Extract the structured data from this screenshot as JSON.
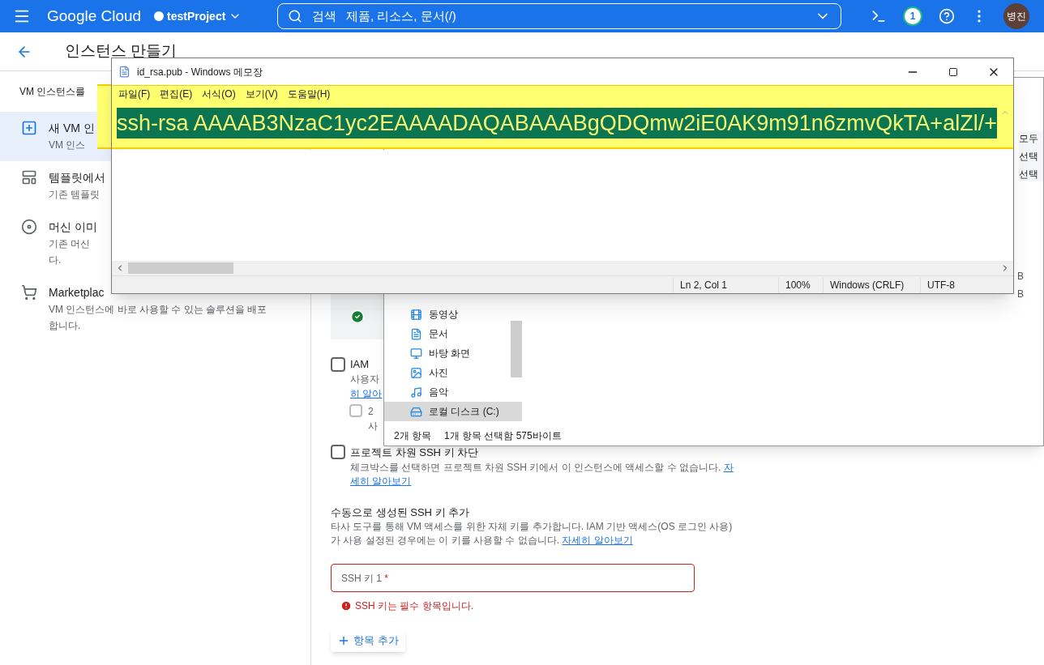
{
  "topbar": {
    "brand": "Google Cloud",
    "project": "testProject",
    "search_label": "검색",
    "search_placeholder": "제품, 리소스, 문서(/)",
    "notifications": "1",
    "avatar": "병진"
  },
  "page": {
    "title": "인스턴스 만들기",
    "intro": "VM 인스턴스를"
  },
  "sidebar": {
    "items": [
      {
        "kind": "new",
        "title": "새 VM 인",
        "desc": "VM 인스",
        "selected": true
      },
      {
        "kind": "template",
        "title": "템플릿에서",
        "desc": "기존 템플릿",
        "selected": false
      },
      {
        "kind": "image",
        "title": "머신 이미",
        "desc": "기존 머신",
        "desc2": "다.",
        "selected": false
      },
      {
        "kind": "market",
        "title": "Marketplac",
        "desc": "VM 인스턴스에 바로 사용할 수 있는 솔루션을 배포",
        "desc2": "합니다.",
        "selected": false
      }
    ]
  },
  "form": {
    "iam": {
      "label": "IAM",
      "desc": "사용자",
      "link": "히 알아",
      "checked": false,
      "sub_label": "2",
      "sub_desc": "사",
      "sub_checked": false
    },
    "block": {
      "label": "프로젝트 차원 SSH 키 차단",
      "desc": "체크박스를 선택하면 프로젝트 차원 SSH 키에서 이 인스턴스에 액세스할 수 없습니다.",
      "link_a": "자",
      "link_b": "세히 알아보기",
      "checked": false
    },
    "manual": {
      "heading": "수동으로 생성된 SSH 키 추가",
      "desc": "타사 도구를 통해 VM 액세스를 위한 자체 키를 추가합니다. IAM 기반 액세스(OS 로그인 사용)가 사용 설정된 경우에는 이 키를 사용할 수 없습니다.",
      "link": "자세히 알아보기"
    },
    "key_field": {
      "label": "SSH 키 1",
      "required": "*",
      "error": "SSH 키는 필수 항목입니다."
    },
    "add_button": "항목 추가"
  },
  "explorer": {
    "ribbon": [
      "모두",
      "선택",
      "선택"
    ],
    "nav": [
      {
        "kind": "video",
        "label": "동영상",
        "selected": false
      },
      {
        "kind": "doc",
        "label": "문서",
        "selected": false
      },
      {
        "kind": "desktop",
        "label": "바탕 화면",
        "selected": false
      },
      {
        "kind": "photo",
        "label": "사진",
        "selected": false
      },
      {
        "kind": "music",
        "label": "음악",
        "selected": false
      },
      {
        "kind": "disk",
        "label": "로컬 디스크 (C:)",
        "selected": true
      }
    ],
    "size_marks": [
      "B",
      "B"
    ],
    "status_count": "2개 항목",
    "status_selection": "1개 항목 선택함 575바이트"
  },
  "notepad": {
    "title": "id_rsa.pub - Windows 메모장",
    "menu": [
      "파일(F)",
      "편집(E)",
      "서식(O)",
      "보기(V)",
      "도움말(H)"
    ],
    "line": "ssh-rsa AAAAB3NzaC1yc2EAAAADAQABAAABgQDQmw2iE0AK9m91n6zmvQkTA+alZl/+",
    "highlighted": true,
    "status": [
      "Ln 2, Col 1",
      "100%",
      "Windows (CRLF)",
      "UTF-8"
    ]
  }
}
